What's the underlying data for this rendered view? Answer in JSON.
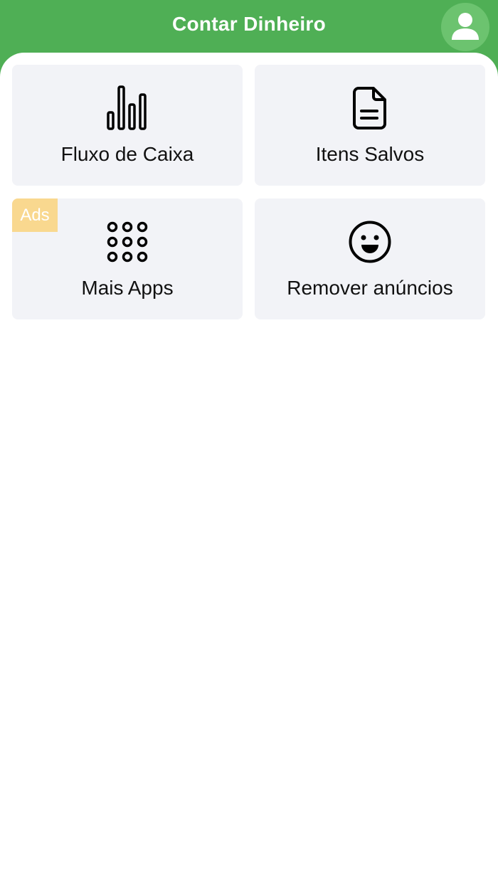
{
  "header": {
    "title": "Contar Dinheiro",
    "avatar_icon": "user-icon",
    "color": "#4faf55"
  },
  "tiles": [
    {
      "label": "Fluxo de Caixa",
      "icon": "bar-chart-icon"
    },
    {
      "label": "Itens Salvos",
      "icon": "document-icon"
    },
    {
      "label": "Mais Apps",
      "icon": "apps-grid-icon",
      "badge": "Ads"
    },
    {
      "label": "Remover anúncios",
      "icon": "smile-icon"
    }
  ]
}
